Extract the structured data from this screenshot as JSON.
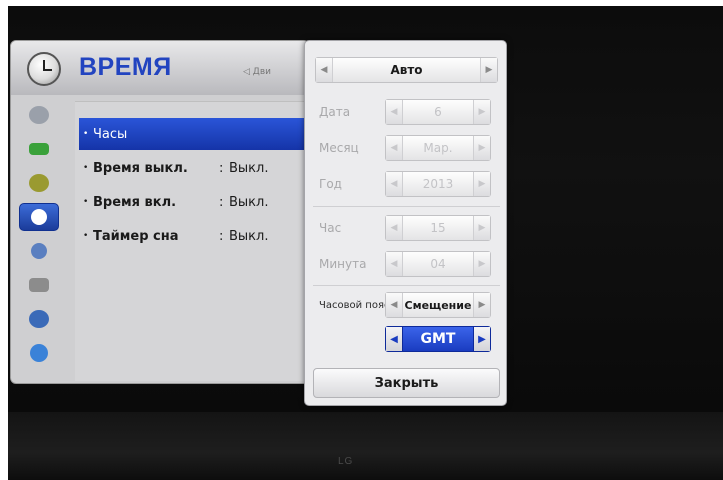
{
  "menu": {
    "title": "ВРЕМЯ",
    "hint": "◁ Дви",
    "items": [
      {
        "label": "Часы",
        "value": "",
        "colon": ""
      },
      {
        "label": "Время выкл.",
        "value": "Выкл.",
        "colon": ":"
      },
      {
        "label": "Время вкл.",
        "value": "Выкл.",
        "colon": ":"
      },
      {
        "label": "Таймер сна",
        "value": "Выкл.",
        "colon": ":"
      }
    ],
    "bullet": "•"
  },
  "side_icons": [
    {
      "name": "picture-icon",
      "color": "#9aa0aa"
    },
    {
      "name": "tv-screen-icon",
      "color": "#3aa13a"
    },
    {
      "name": "speaker-icon",
      "color": "#9a9a30"
    },
    {
      "name": "clock-icon",
      "color": "#ffffff"
    },
    {
      "name": "lock-icon",
      "color": "#5a7fc0"
    },
    {
      "name": "options-icon",
      "color": "#8c8c8c"
    },
    {
      "name": "network-icon",
      "color": "#3a6ab8"
    },
    {
      "name": "help-icon",
      "color": "#3a82d8"
    }
  ],
  "popup": {
    "mode": "Авто",
    "date": {
      "label": "Дата",
      "value": "6"
    },
    "month": {
      "label": "Месяц",
      "value": "Мар."
    },
    "year": {
      "label": "Год",
      "value": "2013"
    },
    "hour": {
      "label": "Час",
      "value": "15"
    },
    "minute": {
      "label": "Минута",
      "value": "04"
    },
    "timezone": {
      "label": "Часовой пояс",
      "value": "Смещение"
    },
    "zone": "GMT",
    "close": "Закрыть",
    "arrow_left": "◀",
    "arrow_right": "▶"
  },
  "tv_brand": "LG",
  "colors": {
    "accent": "#2244c0",
    "selection": "#1a3cc0"
  }
}
